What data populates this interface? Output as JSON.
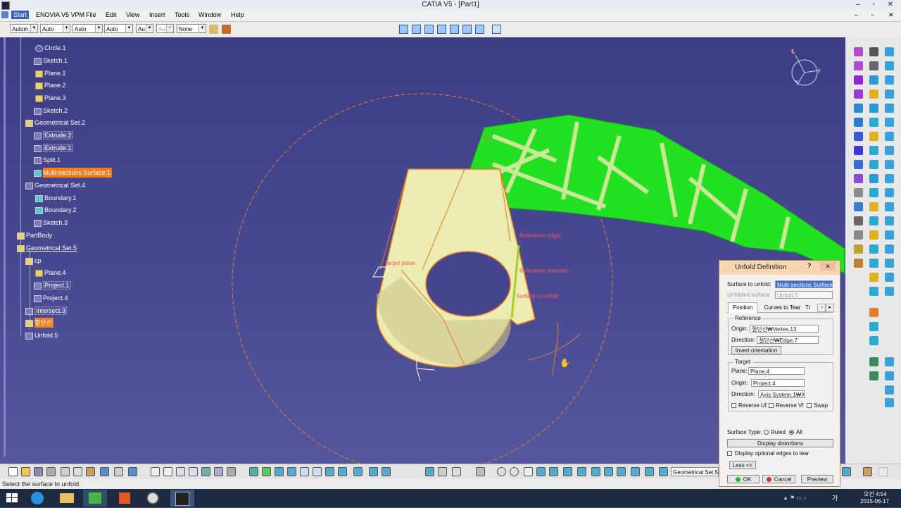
{
  "window": {
    "title": "CATIA V5 - [Part1]"
  },
  "menu": {
    "start": "Start",
    "items": [
      "ENOVIA V5 VPM",
      "File",
      "Edit",
      "View",
      "Insert",
      "Tools",
      "Window",
      "Help"
    ]
  },
  "toolbar": {
    "combos": [
      "Autom.",
      "Auto",
      "Auto",
      "Auto",
      "Au",
      "Au",
      "None"
    ]
  },
  "tree": [
    {
      "label": "Circle.1"
    },
    {
      "label": "Sketch.1"
    },
    {
      "label": "Plane.1"
    },
    {
      "label": "Plane.2"
    },
    {
      "label": "Plane.3"
    },
    {
      "label": "Sketch.2"
    },
    {
      "label": "Geometrical Set.2"
    },
    {
      "label": "Extrude.2"
    },
    {
      "label": "Extrude.1"
    },
    {
      "label": "Split.1"
    },
    {
      "label": "Multi-sections Surface.1"
    },
    {
      "label": "Geometrical Set.4"
    },
    {
      "label": "Boundary.1"
    },
    {
      "label": "Boundary.2"
    },
    {
      "label": "Sketch.3"
    },
    {
      "label": "PartBody"
    },
    {
      "label": "Geometrical Set.5"
    },
    {
      "label": "cp"
    },
    {
      "label": "Plane.4"
    },
    {
      "label": "Project.1"
    },
    {
      "label": "Project.4"
    },
    {
      "label": "Intersect.3"
    },
    {
      "label": "절단선"
    },
    {
      "label": "Unfold.5"
    }
  ],
  "viewport_labels": {
    "target_plane": "Target plane",
    "reference_origin": "Reference origin",
    "reference_direction": "Reference direction",
    "surface_to_unfold": "Surface to unfold",
    "uf": "Uf",
    "compass_x": "x",
    "compass_y": "y",
    "compass_z": "z"
  },
  "dialog": {
    "title": "Unfold Definition",
    "surface_to_unfold_label": "Surface to unfold:",
    "surface_to_unfold_value": "Multi-sections Surface",
    "unfolded_surface_label": "Unfolded surface",
    "unfolded_surface_value": "Unfold.5",
    "tabs": [
      "Position",
      "Curves to Tear",
      "Tr"
    ],
    "reference_group": "Reference",
    "origin_label": "Origin:",
    "origin_value": "절단선₩Vertex.13",
    "direction_label": "Direction:",
    "direction_value": "절단선₩Edge.7",
    "invert_orientation": "Invert orientation",
    "target_group": "Target",
    "plane_label": "Plane:",
    "plane_value": "Plane.4",
    "target_origin_label": "Origin:",
    "target_origin_value": "Project.4",
    "target_direction_label": "Direction:",
    "target_direction_value": "Axis System.1₩X A",
    "reverse_uf": "Reverse Uf",
    "reverse_vf": "Reverse Vf",
    "swap": "Swap",
    "surface_type_label": "Surface Type:",
    "ruled": "Ruled",
    "all": "All",
    "display_distortions": "Display distortions",
    "display_optional_edges": "Display optional edges to tear",
    "less": "Less <<",
    "ok": "OK",
    "cancel": "Cancel",
    "preview": "Preview"
  },
  "bottom": {
    "geoset_combo": "Geometrical Set.5"
  },
  "status": {
    "message": "Select the surface to unfold."
  },
  "taskbar": {
    "time": "오전 4:54",
    "date": "2015-06-17",
    "lang": "가"
  },
  "colors": {
    "viewport_bg": "#3f3f8a",
    "selection": "#f47e1e",
    "surface": "#ecebb0",
    "green_patch": "#22e022",
    "dialog_title": "#f7d7b2"
  }
}
